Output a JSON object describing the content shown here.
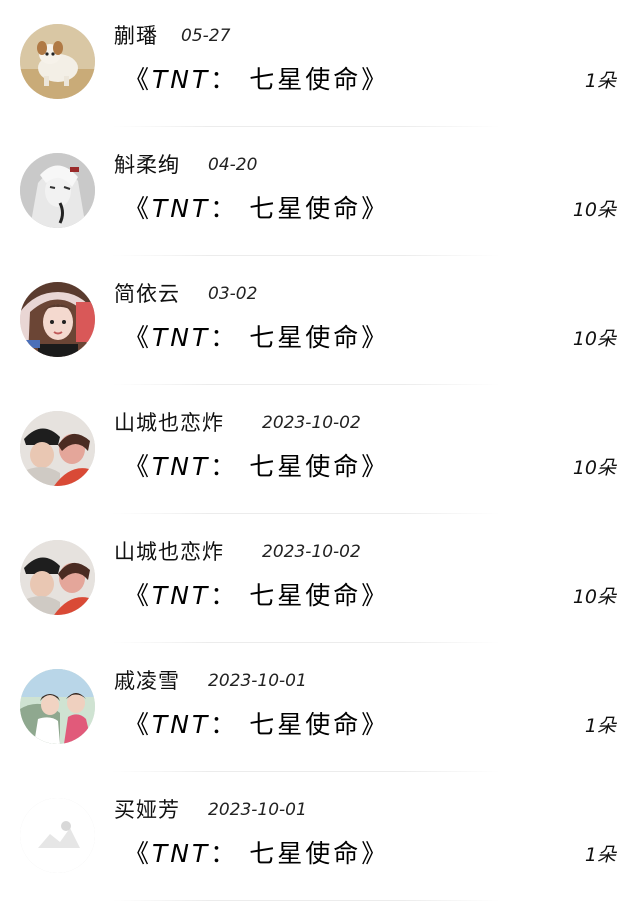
{
  "items": [
    {
      "user": "蒯璠",
      "date": "05-27",
      "title_open": "《",
      "title_tnt": "TNT",
      "title_rest": "： 七星使命",
      "title_close": "》",
      "count": "1朵",
      "avatar": "puppy-avatar"
    },
    {
      "user": "斛柔绚",
      "date": "04-20",
      "title_open": "《",
      "title_tnt": "TNT",
      "title_rest": "： 七星使命",
      "title_close": "》",
      "count": "10朵",
      "avatar": "anime-character-avatar"
    },
    {
      "user": "简依云",
      "date": "03-02",
      "title_open": "《",
      "title_tnt": "TNT",
      "title_rest": "： 七星使命",
      "title_close": "》",
      "count": "10朵",
      "avatar": "girl-photo-avatar"
    },
    {
      "user": "山城也恋炸",
      "date": "2023-10-02",
      "title_open": "《",
      "title_tnt": "TNT",
      "title_rest": "： 七星使命",
      "title_close": "》",
      "count": "10朵",
      "avatar": "couple-photo-avatar"
    },
    {
      "user": "山城也恋炸",
      "date": "2023-10-02",
      "title_open": "《",
      "title_tnt": "TNT",
      "title_rest": "： 七星使命",
      "title_close": "》",
      "count": "10朵",
      "avatar": "couple-photo-avatar"
    },
    {
      "user": "戚凌雪",
      "date": "2023-10-01",
      "title_open": "《",
      "title_tnt": "TNT",
      "title_rest": "： 七星使命",
      "title_close": "》",
      "count": "1朵",
      "avatar": "girl-outdoor-avatar"
    },
    {
      "user": "买娅芳",
      "date": "2023-10-01",
      "title_open": "《",
      "title_tnt": "TNT",
      "title_rest": "： 七星使命",
      "title_close": "》",
      "count": "1朵",
      "avatar": "faded-avatar"
    }
  ],
  "colors": {
    "background": "#ffffff",
    "text": "#111111",
    "divider": "#ececec"
  }
}
